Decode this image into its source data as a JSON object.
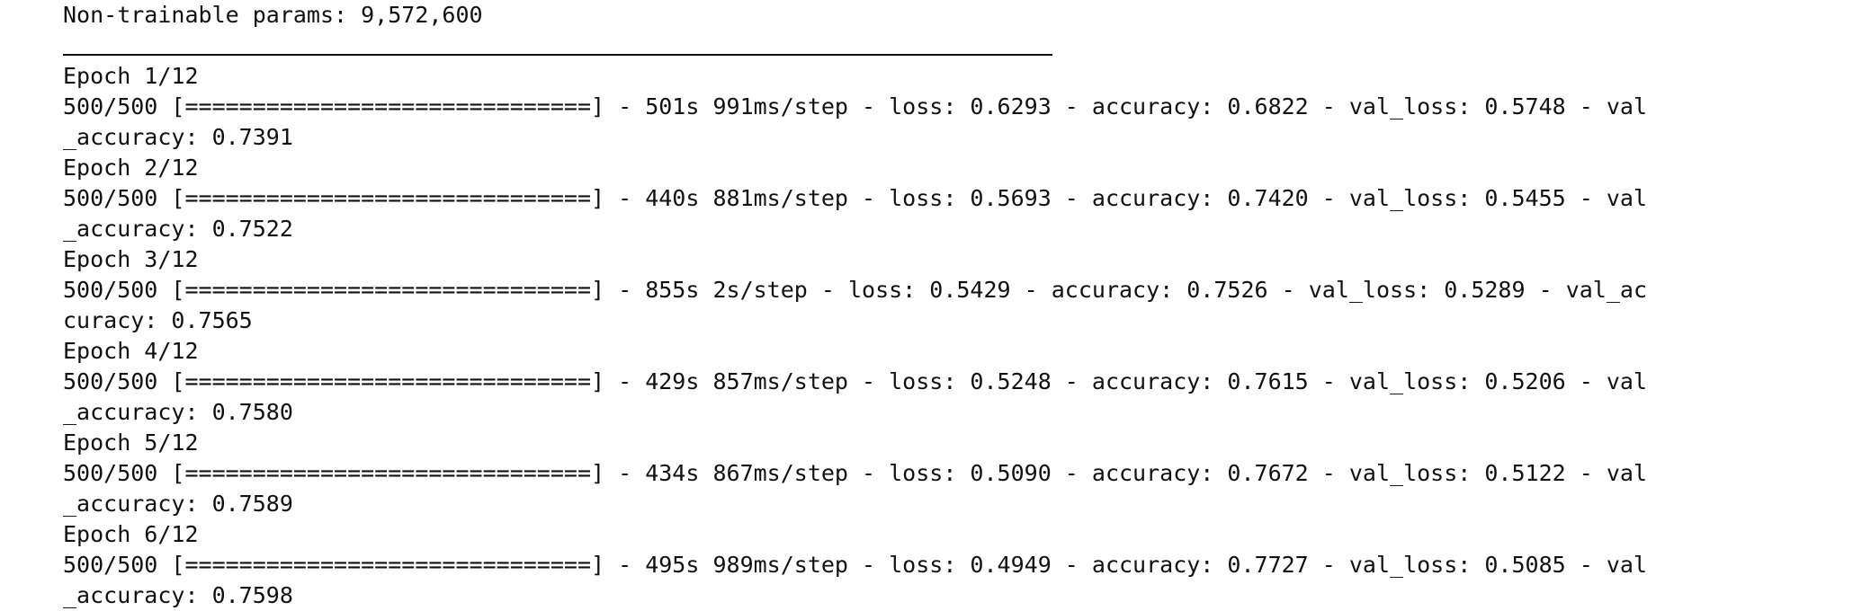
{
  "console": {
    "non_trainable": "Non-trainable params: 9,572,600",
    "epochs": [
      {
        "header": "Epoch 1/12",
        "progress": "500/500 [==============================] - 501s 991ms/step - loss: 0.6293 - accuracy: 0.6822 - val_loss: 0.5748 - val",
        "wrap": "_accuracy: 0.7391"
      },
      {
        "header": "Epoch 2/12",
        "progress": "500/500 [==============================] - 440s 881ms/step - loss: 0.5693 - accuracy: 0.7420 - val_loss: 0.5455 - val",
        "wrap": "_accuracy: 0.7522"
      },
      {
        "header": "Epoch 3/12",
        "progress": "500/500 [==============================] - 855s 2s/step - loss: 0.5429 - accuracy: 0.7526 - val_loss: 0.5289 - val_ac",
        "wrap": "curacy: 0.7565"
      },
      {
        "header": "Epoch 4/12",
        "progress": "500/500 [==============================] - 429s 857ms/step - loss: 0.5248 - accuracy: 0.7615 - val_loss: 0.5206 - val",
        "wrap": "_accuracy: 0.7580"
      },
      {
        "header": "Epoch 5/12",
        "progress": "500/500 [==============================] - 434s 867ms/step - loss: 0.5090 - accuracy: 0.7672 - val_loss: 0.5122 - val",
        "wrap": "_accuracy: 0.7589"
      },
      {
        "header": "Epoch 6/12",
        "progress": "500/500 [==============================] - 495s 989ms/step - loss: 0.4949 - accuracy: 0.7727 - val_loss: 0.5085 - val",
        "wrap": "_accuracy: 0.7598"
      }
    ]
  }
}
